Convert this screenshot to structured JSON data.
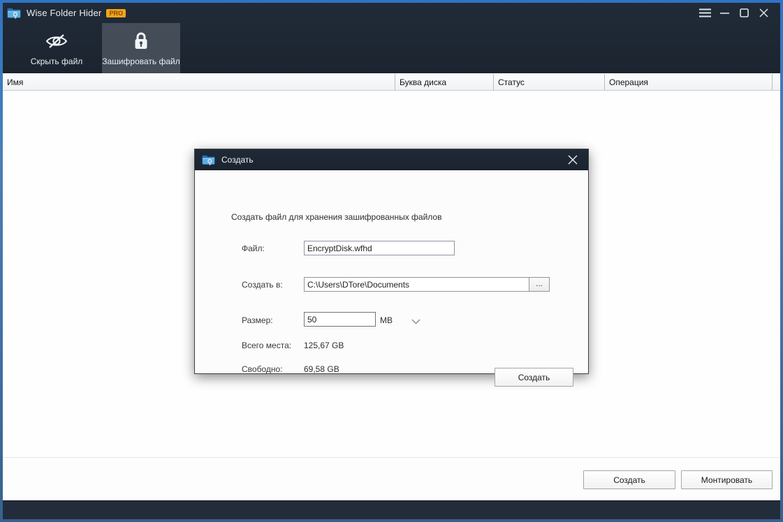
{
  "window": {
    "title": "Wise Folder Hider",
    "badge": "PRO"
  },
  "toolbar": {
    "items": [
      {
        "label": "Скрыть файл",
        "icon": "eye-off-icon"
      },
      {
        "label": "Зашифровать файл",
        "icon": "lock-icon"
      }
    ]
  },
  "table": {
    "columns": [
      "Имя",
      "Буква диска",
      "Статус",
      "Операция"
    ]
  },
  "dialog": {
    "title": "Создать",
    "description": "Создать файл для хранения зашифрованных файлов",
    "file_label": "Файл:",
    "file_value": "EncryptDisk.wfhd",
    "location_label": "Создать в:",
    "location_value": "C:\\Users\\DTore\\Documents",
    "browse_label": "...",
    "size_label": "Размер:",
    "size_value": "50",
    "size_unit": "MB",
    "total_label": "Всего места:",
    "total_value": "125,67 GB",
    "free_label": "Свободно:",
    "free_value": "69,58 GB",
    "create_label": "Создать"
  },
  "bottom_bar": {
    "create_label": "Создать",
    "mount_label": "Монтировать"
  },
  "colors": {
    "window_border": "#3c72b0",
    "titlebar_bg": "#1b242f",
    "toolbar_active_bg": "#434c57",
    "pro_badge_bg": "#f2a51c",
    "pro_badge_text": "#8a4a00"
  }
}
